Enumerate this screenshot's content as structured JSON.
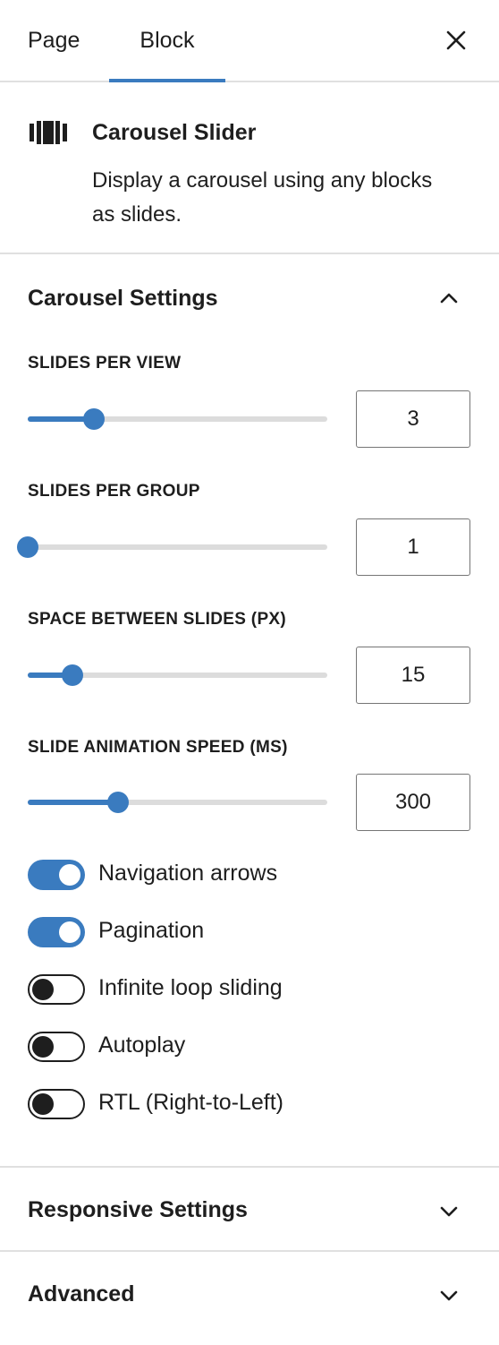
{
  "tabs": {
    "page": "Page",
    "block": "Block",
    "active": "block"
  },
  "block": {
    "title": "Carousel Slider",
    "description": "Display a carousel using any blocks as slides."
  },
  "carousel_settings": {
    "title": "Carousel Settings",
    "expanded": true,
    "controls": [
      {
        "label": "Slides Per View",
        "value": "3",
        "fraction": 0.22
      },
      {
        "label": "Slides Per Group",
        "value": "1",
        "fraction": 0.0
      },
      {
        "label": "Space Between Slides (px)",
        "value": "15",
        "fraction": 0.15
      },
      {
        "label": "Slide Animation Speed (ms)",
        "value": "300",
        "fraction": 0.3
      }
    ],
    "toggles": [
      {
        "label": "Navigation arrows",
        "on": true
      },
      {
        "label": "Pagination",
        "on": true
      },
      {
        "label": "Infinite loop sliding",
        "on": false
      },
      {
        "label": "Autoplay",
        "on": false
      },
      {
        "label": "RTL (Right-to-Left)",
        "on": false
      }
    ]
  },
  "responsive_settings": {
    "title": "Responsive Settings",
    "expanded": false
  },
  "advanced": {
    "title": "Advanced",
    "expanded": false
  },
  "colors": {
    "accent": "#3a7bbf",
    "track": "#dcdcdc",
    "text": "#1e1e1e",
    "border": "#e0e0e0"
  }
}
